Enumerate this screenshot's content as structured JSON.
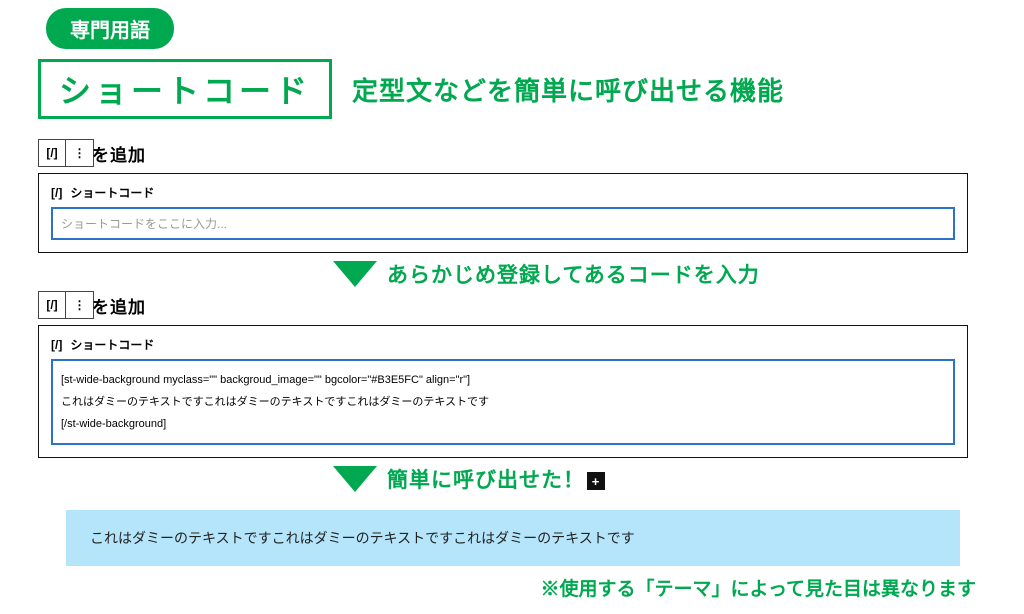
{
  "badge": "専門用語",
  "term": "ショートコード",
  "term_desc": "定型文などを簡単に呼び出せる機能",
  "block1": {
    "icon": "[/]",
    "kebab": "⋮",
    "add_suffix": "を追加",
    "header_icon": "[/]",
    "header": "ショートコード",
    "placeholder": "ショートコードをここに入力..."
  },
  "arrow1": "あらかじめ登録してあるコードを入力",
  "block2": {
    "icon": "[/]",
    "kebab": "⋮",
    "add_suffix": "を追加",
    "header_icon": "[/]",
    "header": "ショートコード",
    "line1": "[st-wide-background myclass=\"\" backgroud_image=\"\" bgcolor=\"#B3E5FC\" align=\"r\"]",
    "line2": "これはダミーのテキストですこれはダミーのテキストですこれはダミーのテキストです",
    "line3": "[/st-wide-background]"
  },
  "arrow2": "簡単に呼び出せた！",
  "plus": "+",
  "result": "これはダミーのテキストですこれはダミーのテキストですこれはダミーのテキストです",
  "footnote": "※使用する「テーマ」によって見た目は異なります"
}
